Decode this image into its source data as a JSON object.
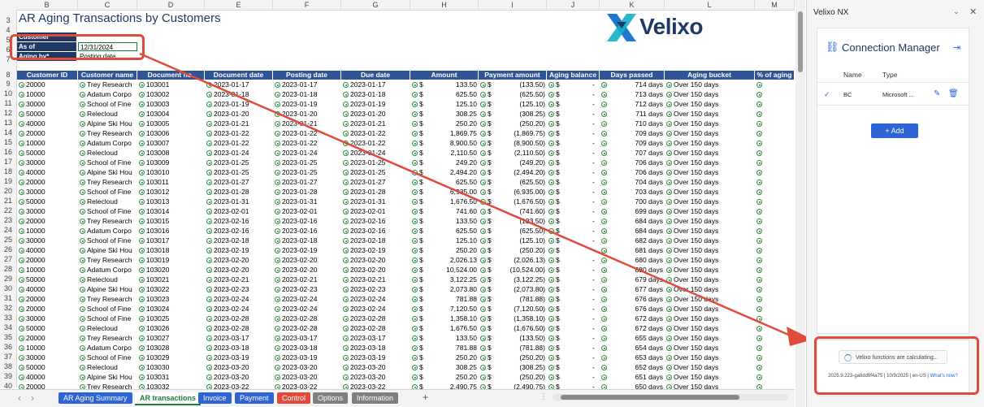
{
  "sheet": {
    "title": "AR Aging Transactions by Customers",
    "column_letters": [
      "B",
      "C",
      "D",
      "E",
      "F",
      "G",
      "H",
      "I",
      "J",
      "K",
      "L",
      "M"
    ],
    "row_numbers": [
      "3",
      "4",
      "5",
      "6",
      "7",
      "8",
      "9",
      "10",
      "11",
      "12",
      "13",
      "14",
      "15",
      "16",
      "17",
      "18",
      "19",
      "20",
      "21",
      "22",
      "23",
      "24",
      "25",
      "26",
      "27",
      "28",
      "29",
      "30",
      "31",
      "32",
      "33",
      "34",
      "35",
      "36",
      "37",
      "38",
      "39",
      "40"
    ],
    "params": [
      {
        "label": "Customer",
        "value": ""
      },
      {
        "label": "As of",
        "value": "12/31/2024"
      },
      {
        "label": "Aging by*",
        "value": "Posting date"
      }
    ],
    "logo_text": "Velixo",
    "headers": [
      "Customer ID",
      "Customer name",
      "Document no.",
      "Document date",
      "Posting date",
      "Due date",
      "Amount",
      "Payment amount",
      "Aging balance",
      "Days passed",
      "Aging bucket",
      "% of aging"
    ],
    "currency": "$",
    "balance_placeholder": "-",
    "rows": [
      [
        "20000",
        "Trey Research",
        "103001",
        "2023-01-17",
        "2023-01-17",
        "2023-01-17",
        "133.50",
        "(133.50)",
        "714 days",
        "Over 150 days"
      ],
      [
        "10000",
        "Adatum Corpo",
        "103002",
        "2023-01-18",
        "2023-01-18",
        "2023-01-18",
        "625.50",
        "(625.50)",
        "713 days",
        "Over 150 days"
      ],
      [
        "30000",
        "School of Fine",
        "103003",
        "2023-01-19",
        "2023-01-19",
        "2023-01-19",
        "125.10",
        "(125.10)",
        "712 days",
        "Over 150 days"
      ],
      [
        "50000",
        "Relecloud",
        "103004",
        "2023-01-20",
        "2023-01-20",
        "2023-01-20",
        "308.25",
        "(308.25)",
        "711 days",
        "Over 150 days"
      ],
      [
        "40000",
        "Alpine Ski Hou",
        "103005",
        "2023-01-21",
        "2023-01-21",
        "2023-01-21",
        "250.20",
        "(250.20)",
        "710 days",
        "Over 150 days"
      ],
      [
        "20000",
        "Trey Research",
        "103006",
        "2023-01-22",
        "2023-01-22",
        "2023-01-22",
        "1,869.75",
        "(1,869.75)",
        "709 days",
        "Over 150 days"
      ],
      [
        "10000",
        "Adatum Corpo",
        "103007",
        "2023-01-22",
        "2023-01-22",
        "2023-01-22",
        "8,900.50",
        "(8,900.50)",
        "709 days",
        "Over 150 days"
      ],
      [
        "50000",
        "Relecloud",
        "103008",
        "2023-01-24",
        "2023-01-24",
        "2023-01-24",
        "2,110.50",
        "(2,110.50)",
        "707 days",
        "Over 150 days"
      ],
      [
        "30000",
        "School of Fine",
        "103009",
        "2023-01-25",
        "2023-01-25",
        "2023-01-25",
        "249.20",
        "(249.20)",
        "706 days",
        "Over 150 days"
      ],
      [
        "40000",
        "Alpine Ski Hou",
        "103010",
        "2023-01-25",
        "2023-01-25",
        "2023-01-25",
        "2,494.20",
        "(2,494.20)",
        "706 days",
        "Over 150 days"
      ],
      [
        "20000",
        "Trey Research",
        "103011",
        "2023-01-27",
        "2023-01-27",
        "2023-01-27",
        "625.50",
        "(625.50)",
        "704 days",
        "Over 150 days"
      ],
      [
        "30000",
        "School of Fine",
        "103012",
        "2023-01-28",
        "2023-01-28",
        "2023-01-28",
        "6,935.00",
        "(6,935.00)",
        "703 days",
        "Over 150 days"
      ],
      [
        "50000",
        "Relecloud",
        "103013",
        "2023-01-31",
        "2023-01-31",
        "2023-01-31",
        "1,676.50",
        "(1,676.50)",
        "700 days",
        "Over 150 days"
      ],
      [
        "30000",
        "School of Fine",
        "103014",
        "2023-02-01",
        "2023-02-01",
        "2023-02-01",
        "741.60",
        "(741.60)",
        "699 days",
        "Over 150 days"
      ],
      [
        "20000",
        "Trey Research",
        "103015",
        "2023-02-16",
        "2023-02-16",
        "2023-02-16",
        "133.50",
        "(133.50)",
        "684 days",
        "Over 150 days"
      ],
      [
        "10000",
        "Adatum Corpo",
        "103016",
        "2023-02-16",
        "2023-02-16",
        "2023-02-16",
        "625.50",
        "(625.50)",
        "684 days",
        "Over 150 days"
      ],
      [
        "30000",
        "School of Fine",
        "103017",
        "2023-02-18",
        "2023-02-18",
        "2023-02-18",
        "125.10",
        "(125.10)",
        "682 days",
        "Over 150 days"
      ],
      [
        "40000",
        "Alpine Ski Hou",
        "103018",
        "2023-02-19",
        "2023-02-19",
        "2023-02-19",
        "250.20",
        "(250.20)",
        "681 days",
        "Over 150 days"
      ],
      [
        "20000",
        "Trey Research",
        "103019",
        "2023-02-20",
        "2023-02-20",
        "2023-02-20",
        "2,026.13",
        "(2,026.13)",
        "680 days",
        "Over 150 days"
      ],
      [
        "10000",
        "Adatum Corpo",
        "103020",
        "2023-02-20",
        "2023-02-20",
        "2023-02-20",
        "10,524.00",
        "(10,524.00)",
        "680 days",
        "Over 150 days"
      ],
      [
        "50000",
        "Relecloud",
        "103021",
        "2023-02-21",
        "2023-02-21",
        "2023-02-21",
        "3,122.25",
        "(3,122.25)",
        "679 days",
        "Over 150 days"
      ],
      [
        "40000",
        "Alpine Ski Hou",
        "103022",
        "2023-02-23",
        "2023-02-23",
        "2023-02-23",
        "2,073.80",
        "(2,073.80)",
        "677 days",
        "Over 150 days"
      ],
      [
        "20000",
        "Trey Research",
        "103023",
        "2023-02-24",
        "2023-02-24",
        "2023-02-24",
        "781.88",
        "(781.88)",
        "676 days",
        "Over 150 days"
      ],
      [
        "20000",
        "School of Fine",
        "103024",
        "2023-02-24",
        "2023-02-24",
        "2023-02-24",
        "7,120.50",
        "(7,120.50)",
        "676 days",
        "Over 150 days"
      ],
      [
        "30000",
        "School of Fine",
        "103025",
        "2023-02-28",
        "2023-02-28",
        "2023-02-28",
        "1,358.10",
        "(1,358.10)",
        "672 days",
        "Over 150 days"
      ],
      [
        "50000",
        "Relecloud",
        "103026",
        "2023-02-28",
        "2023-02-28",
        "2023-02-28",
        "1,676.50",
        "(1,676.50)",
        "672 days",
        "Over 150 days"
      ],
      [
        "20000",
        "Trey Research",
        "103027",
        "2023-03-17",
        "2023-03-17",
        "2023-03-17",
        "133.50",
        "(133.50)",
        "655 days",
        "Over 150 days"
      ],
      [
        "10000",
        "Adatum Corpo",
        "103028",
        "2023-03-18",
        "2023-03-18",
        "2023-03-18",
        "781.88",
        "(781.88)",
        "654 days",
        "Over 150 days"
      ],
      [
        "30000",
        "School of Fine",
        "103029",
        "2023-03-19",
        "2023-03-19",
        "2023-03-19",
        "250.20",
        "(250.20)",
        "653 days",
        "Over 150 days"
      ],
      [
        "50000",
        "Relecloud",
        "103030",
        "2023-03-20",
        "2023-03-20",
        "2023-03-20",
        "308.25",
        "(308.25)",
        "652 days",
        "Over 150 days"
      ],
      [
        "40000",
        "Alpine Ski Hou",
        "103031",
        "2023-03-20",
        "2023-03-20",
        "2023-03-20",
        "250.20",
        "(250.20)",
        "651 days",
        "Over 150 days"
      ],
      [
        "20000",
        "Trey Research",
        "103032",
        "2023-03-22",
        "2023-03-22",
        "2023-03-22",
        "2,490.75",
        "(2,490.75)",
        "650 days",
        "Over 150 days"
      ]
    ]
  },
  "tabs": [
    {
      "label": "AR Aging Summary",
      "color": "#2f64d6",
      "active": false
    },
    {
      "label": "AR transactions",
      "color": "#ffffff",
      "active": true
    },
    {
      "label": "Invoice",
      "color": "#2f64d6",
      "active": false
    },
    {
      "label": "Payment",
      "color": "#2f64d6",
      "active": false
    },
    {
      "label": "Control",
      "color": "#e04a3a",
      "active": false
    },
    {
      "label": "Options",
      "color": "#7f7f7f",
      "active": false
    },
    {
      "label": "Information",
      "color": "#7f7f7f",
      "active": false
    }
  ],
  "tab_nav": {
    "prev": "‹",
    "next": "›",
    "add": "+",
    "more": "⋮"
  },
  "pane": {
    "title": "Velixo NX",
    "card_title": "Connection Manager",
    "col_name": "Name",
    "col_type": "Type",
    "connections": [
      {
        "name": "BC",
        "type": "Microsoft ..."
      }
    ],
    "add_label": "Add",
    "calc_message": "Velixo functions are calculating...",
    "version": "2025.9.223-ga8dd9f4a75 | 10/9/2025 | en-US |",
    "whats_new": "What's now?"
  }
}
